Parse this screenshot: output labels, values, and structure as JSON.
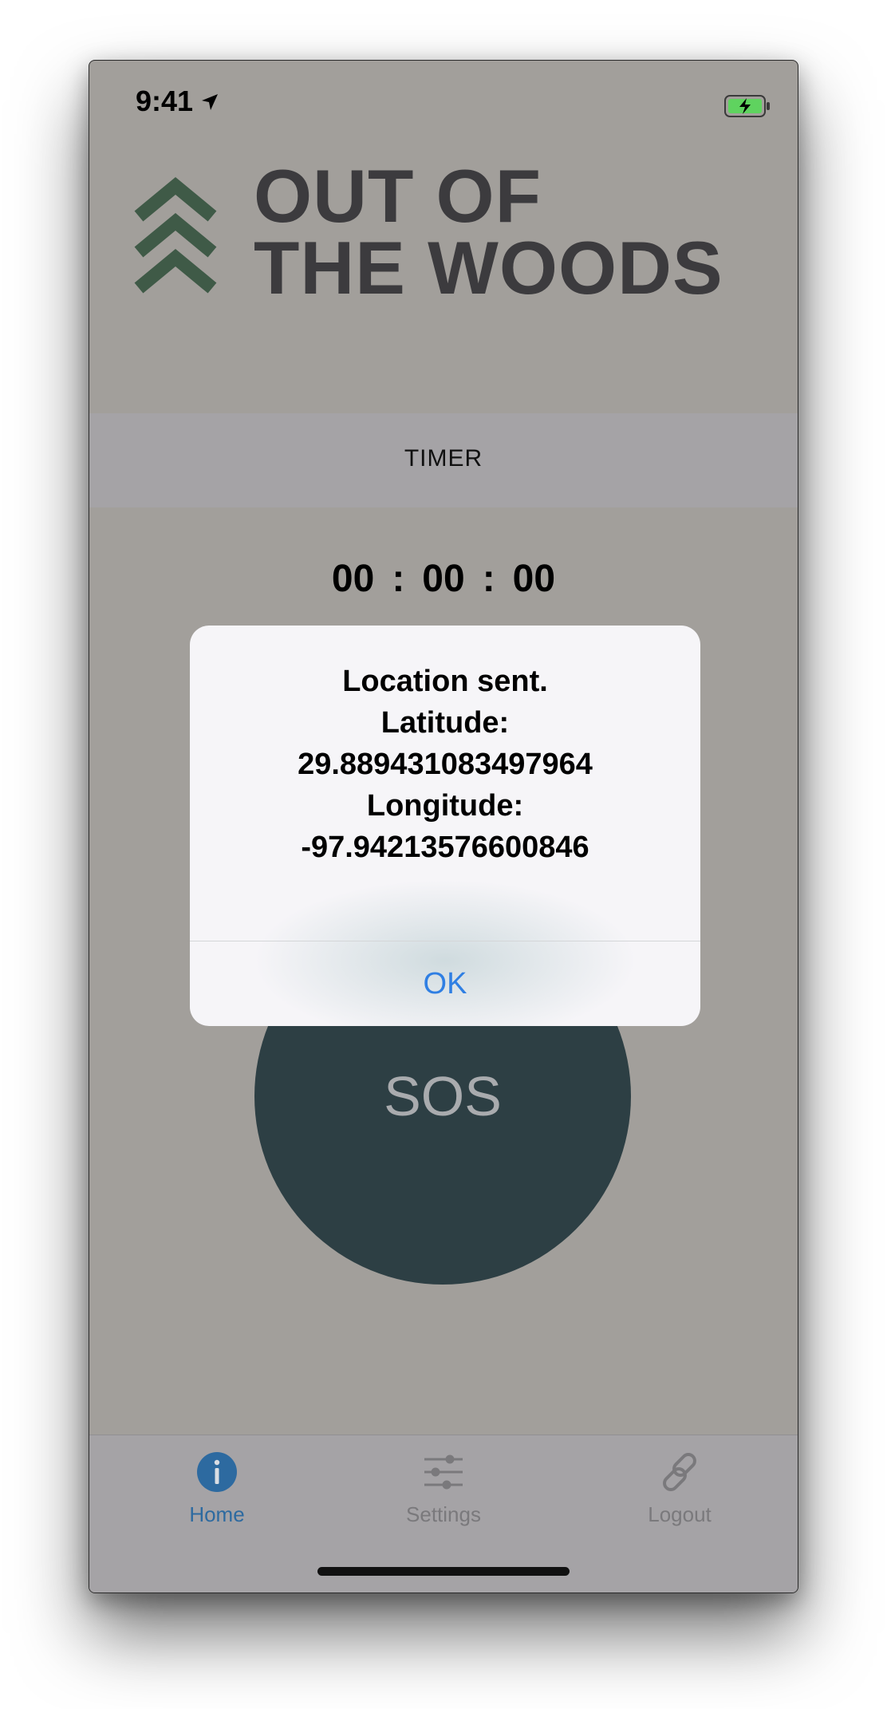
{
  "status_bar": {
    "time": "9:41"
  },
  "logo": {
    "line1": "OUT OF",
    "line2": "THE WOODS"
  },
  "timer": {
    "label": "TIMER",
    "hours": "00",
    "minutes": "00",
    "seconds": "00",
    "separator": ":"
  },
  "sos": {
    "label": "SOS"
  },
  "alert": {
    "title": "Location sent.",
    "lat_label": "Latitude:",
    "lat_value": "29.889431083497964",
    "lon_label": "Longitude:",
    "lon_value": "-97.94213576600846",
    "ok_label": "OK"
  },
  "tabs": [
    {
      "label": "Home",
      "icon": "info-icon",
      "active": true
    },
    {
      "label": "Settings",
      "icon": "sliders-icon",
      "active": false
    },
    {
      "label": "Logout",
      "icon": "link-icon",
      "active": false
    }
  ],
  "colors": {
    "background": "#a29f9b",
    "logo_green": "#3f5a47",
    "sos": "#2d3f44",
    "active_tab": "#2d6aa0",
    "inactive_tab": "#7a797c",
    "alert_button": "#2f7fe3"
  }
}
